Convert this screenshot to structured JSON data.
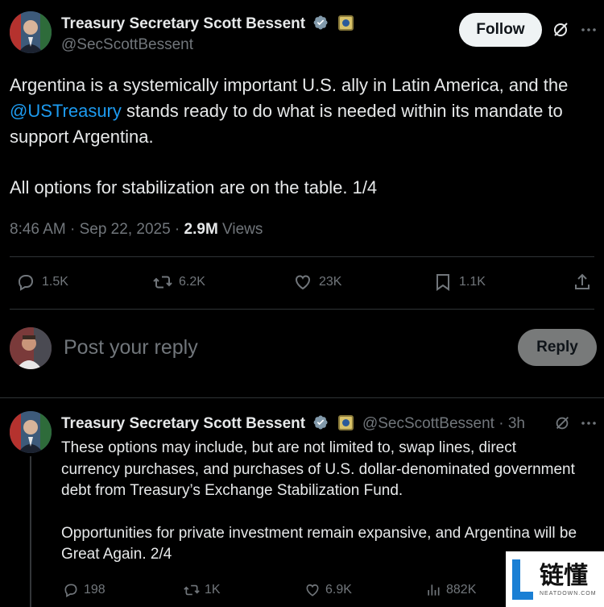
{
  "main_tweet": {
    "author_name": "Treasury Secretary Scott Bessent",
    "handle": "@SecScottBessent",
    "follow_label": "Follow",
    "text_before": "Argentina is a systemically important U.S. ally in Latin America, and the ",
    "mention": "@USTreasury",
    "text_after": " stands ready to do what is needed within its mandate to support Argentina.",
    "text_p2": "All options for stabilization are on the table. 1/4",
    "time": "8:46 AM · Sep 22, 2025 · ",
    "views_count": "2.9M",
    "views_label": " Views",
    "stats": {
      "replies": "1.5K",
      "reposts": "6.2K",
      "likes": "23K",
      "bookmarks": "1.1K"
    }
  },
  "reply_box": {
    "placeholder": "Post your reply",
    "button_label": "Reply"
  },
  "thread_tweet": {
    "author_name": "Treasury Secretary Scott Bessent",
    "handle_time": "@SecScottBessent · 3h",
    "text_p1": "These options may include, but are not limited to, swap lines, direct currency purchases, and purchases of U.S. dollar-denominated government debt from Treasury’s Exchange Stabilization Fund.",
    "text_p2": "Opportunities for private investment remain expansive, and Argentina will be Great Again. 2/4",
    "stats": {
      "replies": "198",
      "reposts": "1K",
      "likes": "6.9K",
      "views": "882K"
    }
  },
  "watermark": {
    "cn_text": "链懂",
    "en_text": "NEATDOWN.COM"
  },
  "colors": {
    "background": "#000000",
    "text": "#e7e9ea",
    "muted": "#71767b",
    "accent": "#1d9bf0",
    "divider": "#2f3336"
  }
}
